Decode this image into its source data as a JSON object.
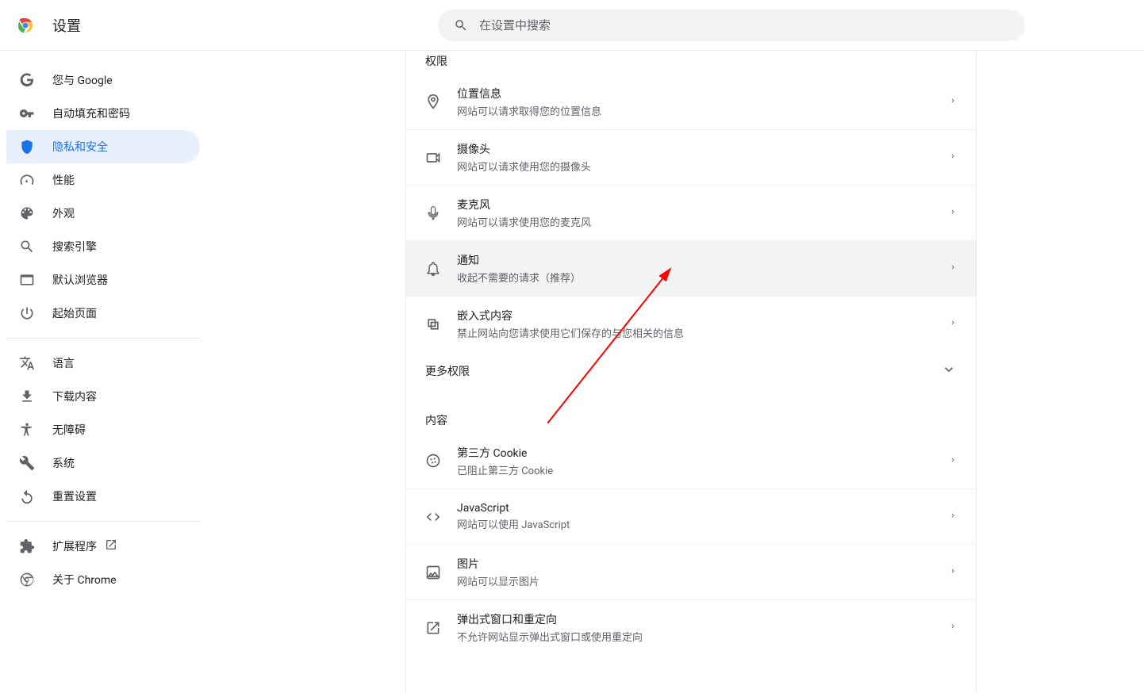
{
  "header": {
    "title": "设置",
    "search_placeholder": "在设置中搜索"
  },
  "sidebar": {
    "items": [
      {
        "id": "you-and-google",
        "label": "您与 Google"
      },
      {
        "id": "autofill",
        "label": "自动填充和密码"
      },
      {
        "id": "privacy",
        "label": "隐私和安全",
        "active": true
      },
      {
        "id": "performance",
        "label": "性能"
      },
      {
        "id": "appearance",
        "label": "外观"
      },
      {
        "id": "search-engine",
        "label": "搜索引擎"
      },
      {
        "id": "default-browser",
        "label": "默认浏览器"
      },
      {
        "id": "on-startup",
        "label": "起始页面"
      }
    ],
    "items2": [
      {
        "id": "languages",
        "label": "语言"
      },
      {
        "id": "downloads",
        "label": "下载内容"
      },
      {
        "id": "accessibility",
        "label": "无障碍"
      },
      {
        "id": "system",
        "label": "系统"
      },
      {
        "id": "reset",
        "label": "重置设置"
      }
    ],
    "items3": [
      {
        "id": "extensions",
        "label": "扩展程序"
      },
      {
        "id": "about",
        "label": "关于 Chrome"
      }
    ]
  },
  "main": {
    "sections": {
      "permissions_title": "权限",
      "content_title": "内容",
      "more_permissions": "更多权限"
    },
    "permissions": [
      {
        "id": "location",
        "title": "位置信息",
        "sub": "网站可以请求取得您的位置信息"
      },
      {
        "id": "camera",
        "title": "摄像头",
        "sub": "网站可以请求使用您的摄像头"
      },
      {
        "id": "microphone",
        "title": "麦克风",
        "sub": "网站可以请求使用您的麦克风"
      },
      {
        "id": "notifications",
        "title": "通知",
        "sub": "收起不需要的请求（推荐）",
        "hovered": true
      },
      {
        "id": "embedded",
        "title": "嵌入式内容",
        "sub": "禁止网站向您请求使用它们保存的与您相关的信息"
      }
    ],
    "content": [
      {
        "id": "cookies",
        "title": "第三方 Cookie",
        "sub": "已阻止第三方 Cookie"
      },
      {
        "id": "javascript",
        "title": "JavaScript",
        "sub": "网站可以使用 JavaScript"
      },
      {
        "id": "images",
        "title": "图片",
        "sub": "网站可以显示图片"
      },
      {
        "id": "popups",
        "title": "弹出式窗口和重定向",
        "sub": "不允许网站显示弹出式窗口或使用重定向"
      }
    ]
  }
}
